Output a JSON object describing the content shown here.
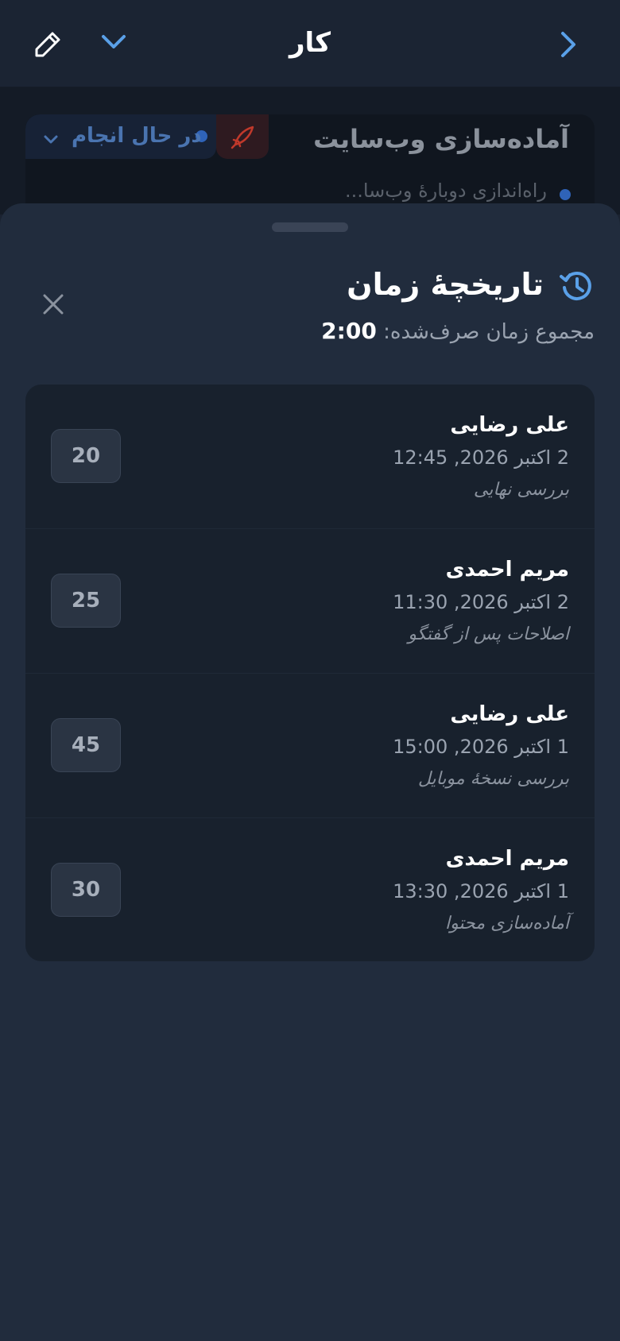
{
  "header": {
    "title": "کار",
    "back_icon": "chevron-right-icon",
    "dropdown_icon": "chevron-down-icon",
    "edit_icon": "pencil-icon"
  },
  "task": {
    "title": "آماده‌سازی وب‌سایت",
    "status_label": "در حال انجام",
    "status_color": "#2f63b8",
    "priority_icon": "rocket-icon",
    "priority_color": "#c0392b",
    "subtask_preview": "راه‌اندازی دوبارهٔ وب‌سا..."
  },
  "sheet": {
    "title": "تاریخچهٔ زمان",
    "title_icon": "history-icon",
    "close_icon": "close-icon",
    "total_label": "مجموع زمان صرف‌شده: ",
    "total_value": "2:00"
  },
  "entries": [
    {
      "name": "علی رضایی",
      "datetime": "2 اکتبر 2026, 12:45",
      "note": "بررسی نهایی",
      "minutes": "20"
    },
    {
      "name": "مریم احمدی",
      "datetime": "2 اکتبر 2026, 11:30",
      "note": "اصلاحات پس از گفتگو",
      "minutes": "25"
    },
    {
      "name": "علی رضایی",
      "datetime": "1 اکتبر 2026, 15:00",
      "note": "بررسی نسخهٔ موبایل",
      "minutes": "45"
    },
    {
      "name": "مریم احمدی",
      "datetime": "1 اکتبر 2026, 13:30",
      "note": "آماده‌سازی محتوا",
      "minutes": "30"
    }
  ],
  "colors": {
    "accent": "#5aa0e8",
    "background": "#1b2331",
    "sheet": "#212c3d"
  }
}
